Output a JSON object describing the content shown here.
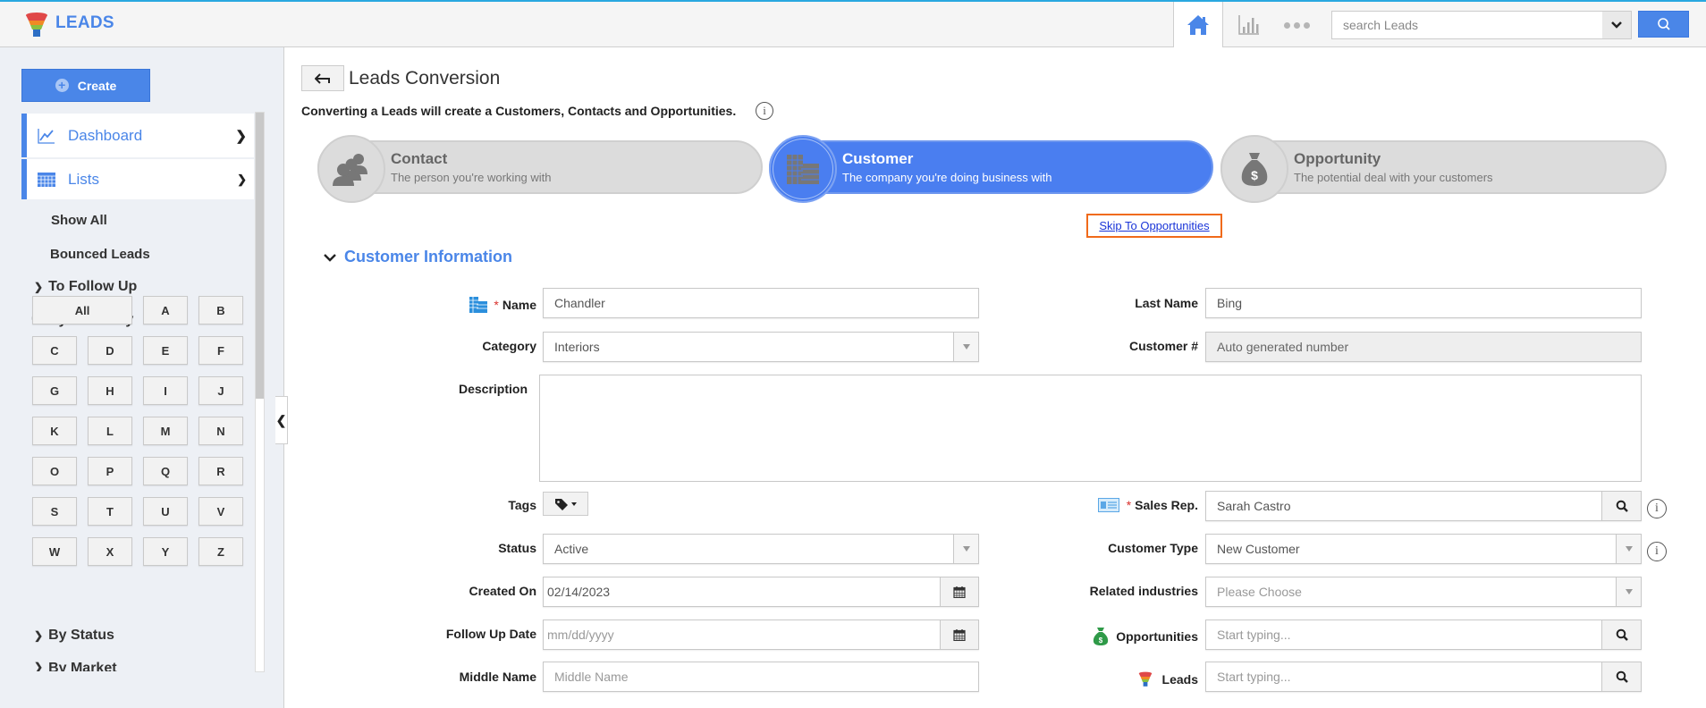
{
  "app": {
    "title": "LEADS",
    "search_placeholder": "search Leads"
  },
  "colors": {
    "accent": "#4a86e8",
    "active_step": "#4a7ef0",
    "highlight_border": "#f06a1a",
    "top_border": "#29a8e0"
  },
  "sidebar": {
    "create_label": "Create",
    "nav": [
      {
        "label": "Dashboard",
        "icon": "line-chart-icon",
        "chevron": "right"
      },
      {
        "label": "Lists",
        "icon": "table-icon",
        "chevron": "down"
      }
    ],
    "list_items": [
      "Show All",
      "Bounced Leads"
    ],
    "tree": [
      {
        "label": "To Follow Up",
        "expanded": false
      },
      {
        "label": "By Directory",
        "expanded": true
      },
      {
        "label": "By Status",
        "expanded": false
      },
      {
        "label": "By Market",
        "expanded": false
      }
    ],
    "letters": [
      "All",
      "A",
      "B",
      "C",
      "D",
      "E",
      "F",
      "G",
      "H",
      "I",
      "J",
      "K",
      "L",
      "M",
      "N",
      "O",
      "P",
      "Q",
      "R",
      "S",
      "T",
      "U",
      "V",
      "W",
      "X",
      "Y",
      "Z"
    ]
  },
  "main": {
    "title": "Leads Conversion",
    "subtitle": "Converting a Leads will create a Customers, Contacts and Opportunities.",
    "steps": [
      {
        "title": "Contact",
        "subtitle": "The person you're working with",
        "icon": "people-icon",
        "active": false
      },
      {
        "title": "Customer",
        "subtitle": "The company you're doing business with",
        "icon": "building-icon",
        "active": true
      },
      {
        "title": "Opportunity",
        "subtitle": "The potential deal with your customers",
        "icon": "money-bag-icon",
        "active": false
      }
    ],
    "skip_link": "Skip To Opportunities",
    "section_title": "Customer Information",
    "form": {
      "name": {
        "label": "Name",
        "value": "Chandler",
        "required": true
      },
      "last_name": {
        "label": "Last Name",
        "value": "Bing"
      },
      "category": {
        "label": "Category",
        "value": "Interiors"
      },
      "customer_no": {
        "label": "Customer #",
        "value": "Auto generated number"
      },
      "description": {
        "label": "Description",
        "value": ""
      },
      "tags": {
        "label": "Tags"
      },
      "sales_rep": {
        "label": "Sales Rep.",
        "value": "Sarah Castro",
        "required": true
      },
      "status": {
        "label": "Status",
        "value": "Active"
      },
      "customer_type": {
        "label": "Customer Type",
        "value": "New Customer"
      },
      "created_on": {
        "label": "Created On",
        "value": "02/14/2023"
      },
      "related_industries": {
        "label": "Related industries",
        "placeholder": "Please Choose"
      },
      "follow_up_date": {
        "label": "Follow Up Date",
        "placeholder": "mm/dd/yyyy"
      },
      "opportunities": {
        "label": "Opportunities",
        "placeholder": "Start typing..."
      },
      "middle_name": {
        "label": "Middle Name",
        "placeholder": "Middle Name"
      },
      "leads": {
        "label": "Leads",
        "placeholder": "Start typing..."
      }
    }
  }
}
